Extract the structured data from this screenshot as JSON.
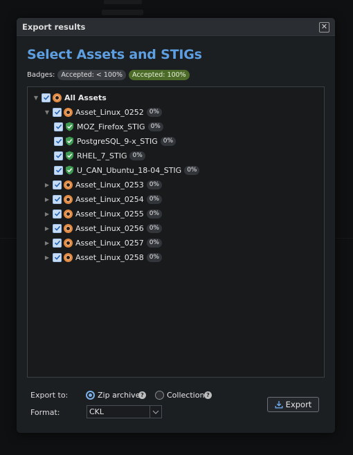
{
  "dialog": {
    "title": "Export results",
    "close_glyph": "✕",
    "heading": "Select Assets and STIGs"
  },
  "badges": {
    "label": "Badges:",
    "items": [
      {
        "text": "Accepted: < 100%",
        "kind": "partial",
        "color": "#3a3e43"
      },
      {
        "text": "Accepted: 100%",
        "kind": "full",
        "color": "#4c6b28"
      }
    ]
  },
  "tree": {
    "root": {
      "label": "All Assets",
      "expanded": true,
      "checked": true,
      "icon": "asset-icon"
    },
    "assets": [
      {
        "label": "Asset_Linux_0252",
        "pct": "0%",
        "expanded": true,
        "checked": true,
        "stigs": [
          {
            "label": "MOZ_Firefox_STIG",
            "pct": "0%",
            "checked": true,
            "icon": "shield-check-icon"
          },
          {
            "label": "PostgreSQL_9-x_STIG",
            "pct": "0%",
            "checked": true,
            "icon": "shield-check-icon"
          },
          {
            "label": "RHEL_7_STIG",
            "pct": "0%",
            "checked": true,
            "icon": "shield-check-icon"
          },
          {
            "label": "U_CAN_Ubuntu_18-04_STIG",
            "pct": "0%",
            "checked": true,
            "icon": "shield-check-icon"
          }
        ]
      },
      {
        "label": "Asset_Linux_0253",
        "pct": "0%",
        "expanded": false,
        "checked": true
      },
      {
        "label": "Asset_Linux_0254",
        "pct": "0%",
        "expanded": false,
        "checked": true
      },
      {
        "label": "Asset_Linux_0255",
        "pct": "0%",
        "expanded": false,
        "checked": true
      },
      {
        "label": "Asset_Linux_0256",
        "pct": "0%",
        "expanded": false,
        "checked": true
      },
      {
        "label": "Asset_Linux_0257",
        "pct": "0%",
        "expanded": false,
        "checked": true
      },
      {
        "label": "Asset_Linux_0258",
        "pct": "0%",
        "expanded": false,
        "checked": true
      }
    ]
  },
  "footer": {
    "export_to_label": "Export to:",
    "options": [
      {
        "label": "Zip archive",
        "selected": true,
        "help": "?"
      },
      {
        "label": "Collection",
        "selected": false,
        "help": "?"
      }
    ],
    "format_label": "Format:",
    "format_value": "CKL",
    "export_button": "Export"
  },
  "colors": {
    "accent": "#5d9fe0",
    "asset_icon": "#e38a43",
    "stig_icon": "#3f9a52",
    "checkbox": "#c7dbf3"
  }
}
